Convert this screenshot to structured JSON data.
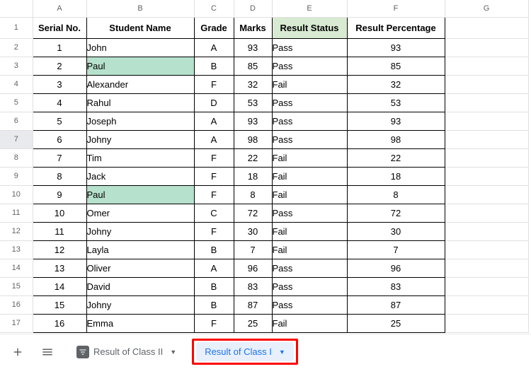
{
  "columns": [
    "A",
    "B",
    "C",
    "D",
    "E",
    "F",
    "G"
  ],
  "headers": {
    "serial": "Serial No.",
    "student": "Student  Name",
    "grade": "Grade",
    "marks": "Marks",
    "status": "Result Status",
    "percent": "Result Percentage"
  },
  "rows": [
    {
      "n": "1",
      "serial": "1",
      "student": "John",
      "grade": "A",
      "marks": "93",
      "status": "Pass",
      "percent": "93",
      "hl": false
    },
    {
      "n": "2",
      "serial": "2",
      "student": "Paul",
      "grade": "B",
      "marks": "85",
      "status": "Pass",
      "percent": "85",
      "hl": true
    },
    {
      "n": "3",
      "serial": "3",
      "student": "Alexander",
      "grade": "F",
      "marks": "32",
      "status": "Fail",
      "percent": "32",
      "hl": false
    },
    {
      "n": "4",
      "serial": "4",
      "student": "Rahul",
      "grade": "D",
      "marks": "53",
      "status": "Pass",
      "percent": "53",
      "hl": false
    },
    {
      "n": "5",
      "serial": "5",
      "student": "Joseph",
      "grade": "A",
      "marks": "93",
      "status": "Pass",
      "percent": "93",
      "hl": false
    },
    {
      "n": "6",
      "serial": "6",
      "student": "Johny",
      "grade": "A",
      "marks": "98",
      "status": "Pass",
      "percent": "98",
      "hl": false
    },
    {
      "n": "7",
      "serial": "7",
      "student": "Tim",
      "grade": "F",
      "marks": "22",
      "status": "Fail",
      "percent": "22",
      "hl": false
    },
    {
      "n": "8",
      "serial": "8",
      "student": "Jack",
      "grade": "F",
      "marks": "18",
      "status": "Fail",
      "percent": "18",
      "hl": false
    },
    {
      "n": "9",
      "serial": "9",
      "student": "Paul",
      "grade": "F",
      "marks": "8",
      "status": "Fail",
      "percent": "8",
      "hl": true
    },
    {
      "n": "10",
      "serial": "10",
      "student": "Omer",
      "grade": "C",
      "marks": "72",
      "status": "Pass",
      "percent": "72",
      "hl": false
    },
    {
      "n": "11",
      "serial": "11",
      "student": "Johny",
      "grade": "F",
      "marks": "30",
      "status": "Fail",
      "percent": "30",
      "hl": false
    },
    {
      "n": "12",
      "serial": "12",
      "student": "Layla",
      "grade": "B",
      "marks": "7",
      "status": "Fail",
      "percent": "7",
      "hl": false
    },
    {
      "n": "13",
      "serial": "13",
      "student": "Oliver",
      "grade": "A",
      "marks": "96",
      "status": "Pass",
      "percent": "96",
      "hl": false
    },
    {
      "n": "14",
      "serial": "14",
      "student": "David",
      "grade": "B",
      "marks": "83",
      "status": "Pass",
      "percent": "83",
      "hl": false
    },
    {
      "n": "15",
      "serial": "15",
      "student": "Johny",
      "grade": "B",
      "marks": "87",
      "status": "Pass",
      "percent": "87",
      "hl": false
    },
    {
      "n": "16",
      "serial": "16",
      "student": "Emma",
      "grade": "F",
      "marks": "25",
      "status": "Fail",
      "percent": "25",
      "hl": false
    }
  ],
  "selected_row_header": "7",
  "tabs": {
    "inactive": "Result of Class II",
    "active": "Result of Class I"
  },
  "chart_data": {
    "type": "table",
    "columns": [
      "Serial No.",
      "Student Name",
      "Grade",
      "Marks",
      "Result Status",
      "Result Percentage"
    ],
    "data": [
      [
        1,
        "John",
        "A",
        93,
        "Pass",
        93
      ],
      [
        2,
        "Paul",
        "B",
        85,
        "Pass",
        85
      ],
      [
        3,
        "Alexander",
        "F",
        32,
        "Fail",
        32
      ],
      [
        4,
        "Rahul",
        "D",
        53,
        "Pass",
        53
      ],
      [
        5,
        "Joseph",
        "A",
        93,
        "Pass",
        93
      ],
      [
        6,
        "Johny",
        "A",
        98,
        "Pass",
        98
      ],
      [
        7,
        "Tim",
        "F",
        22,
        "Fail",
        22
      ],
      [
        8,
        "Jack",
        "F",
        18,
        "Fail",
        18
      ],
      [
        9,
        "Paul",
        "F",
        8,
        "Fail",
        8
      ],
      [
        10,
        "Omer",
        "C",
        72,
        "Pass",
        72
      ],
      [
        11,
        "Johny",
        "F",
        30,
        "Fail",
        30
      ],
      [
        12,
        "Layla",
        "B",
        7,
        "Fail",
        7
      ],
      [
        13,
        "Oliver",
        "A",
        96,
        "Pass",
        96
      ],
      [
        14,
        "David",
        "B",
        83,
        "Pass",
        83
      ],
      [
        15,
        "Johny",
        "B",
        87,
        "Pass",
        87
      ],
      [
        16,
        "Emma",
        "F",
        25,
        "Fail",
        25
      ]
    ]
  }
}
